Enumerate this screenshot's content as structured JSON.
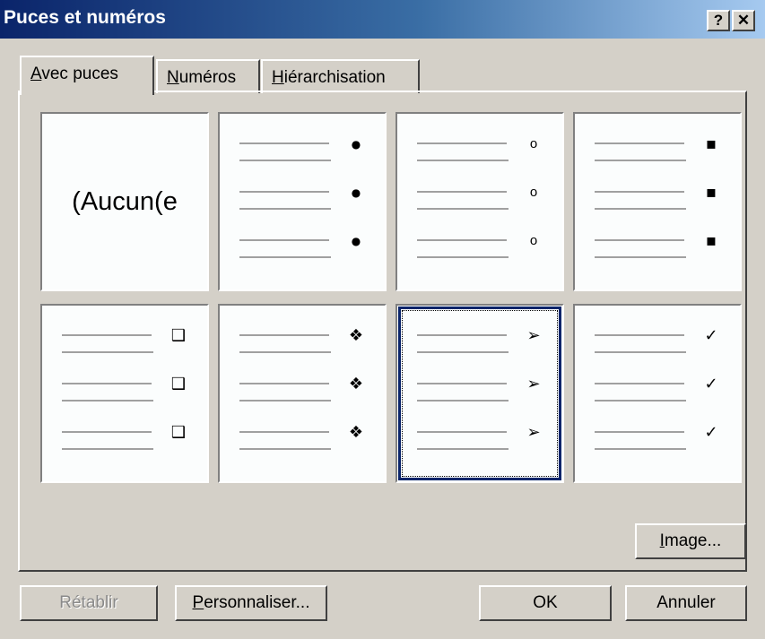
{
  "window": {
    "title": "Puces et numéros",
    "help_label": "?",
    "close_label": "✕",
    "title_gradient": [
      "#0a246a",
      "#a6caf0"
    ]
  },
  "tabs": [
    {
      "first": "A",
      "rest": "vec puces",
      "active": true
    },
    {
      "first": "N",
      "rest": "uméros",
      "active": false
    },
    {
      "first": "H",
      "rest": "iérarchisation",
      "active": false
    }
  ],
  "bullets": [
    {
      "name": "none",
      "label": "(Aucun(e",
      "glyph": ""
    },
    {
      "name": "bullet-dot",
      "glyph": "●"
    },
    {
      "name": "bullet-circle",
      "glyph": "o"
    },
    {
      "name": "bullet-square",
      "glyph": "▪"
    },
    {
      "name": "bullet-hollow-square",
      "glyph": "❑"
    },
    {
      "name": "bullet-four-diamonds",
      "glyph": "❖"
    },
    {
      "name": "bullet-arrowhead",
      "glyph": "➢",
      "selected": true
    },
    {
      "name": "bullet-checkmark",
      "glyph": "✓"
    }
  ],
  "buttons": {
    "image": {
      "first": "I",
      "rest": "mage..."
    },
    "reset": {
      "label": "Rétablir",
      "disabled": true
    },
    "customize": {
      "first": "P",
      "rest": "ersonnaliser..."
    },
    "ok": {
      "label": "OK"
    },
    "cancel": {
      "label": "Annuler"
    }
  },
  "colors": {
    "face": "#d4d0c8",
    "cell_bg": "#fbfdfd",
    "selection": "#0a246a"
  }
}
